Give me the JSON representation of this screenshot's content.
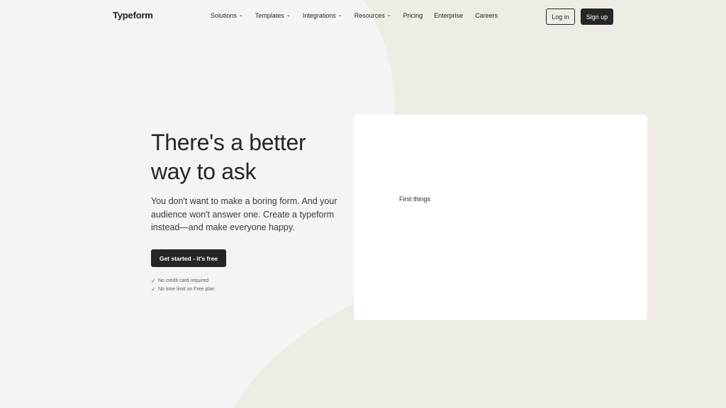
{
  "header": {
    "logo": "Typeform",
    "nav": [
      {
        "label": "Solutions",
        "dropdown": true
      },
      {
        "label": "Templates",
        "dropdown": true
      },
      {
        "label": "Integrations",
        "dropdown": true
      },
      {
        "label": "Resources",
        "dropdown": true
      },
      {
        "label": "Pricing",
        "dropdown": false
      },
      {
        "label": "Enterprise",
        "dropdown": false
      },
      {
        "label": "Careers",
        "dropdown": false
      }
    ],
    "login_label": "Log in",
    "signup_label": "Sign up"
  },
  "hero": {
    "title_line1": "There's a better",
    "title_line2": "way to ask",
    "subtitle": "You don't want to make a boring form. And your audience won't answer one. Create a typeform instead—and make everyone happy.",
    "cta_label": "Get started - it's free",
    "checks": [
      "No credit card required",
      "No time limit on Free plan"
    ],
    "check_icon": "✓"
  },
  "form_card": {
    "text": "First things"
  },
  "colors": {
    "background": "#f5f4f2",
    "shape": "#efebe5",
    "dark": "#262627",
    "card": "#ffffff"
  },
  "icons": {
    "chevron": "chevron-down-icon",
    "check": "check-icon"
  }
}
